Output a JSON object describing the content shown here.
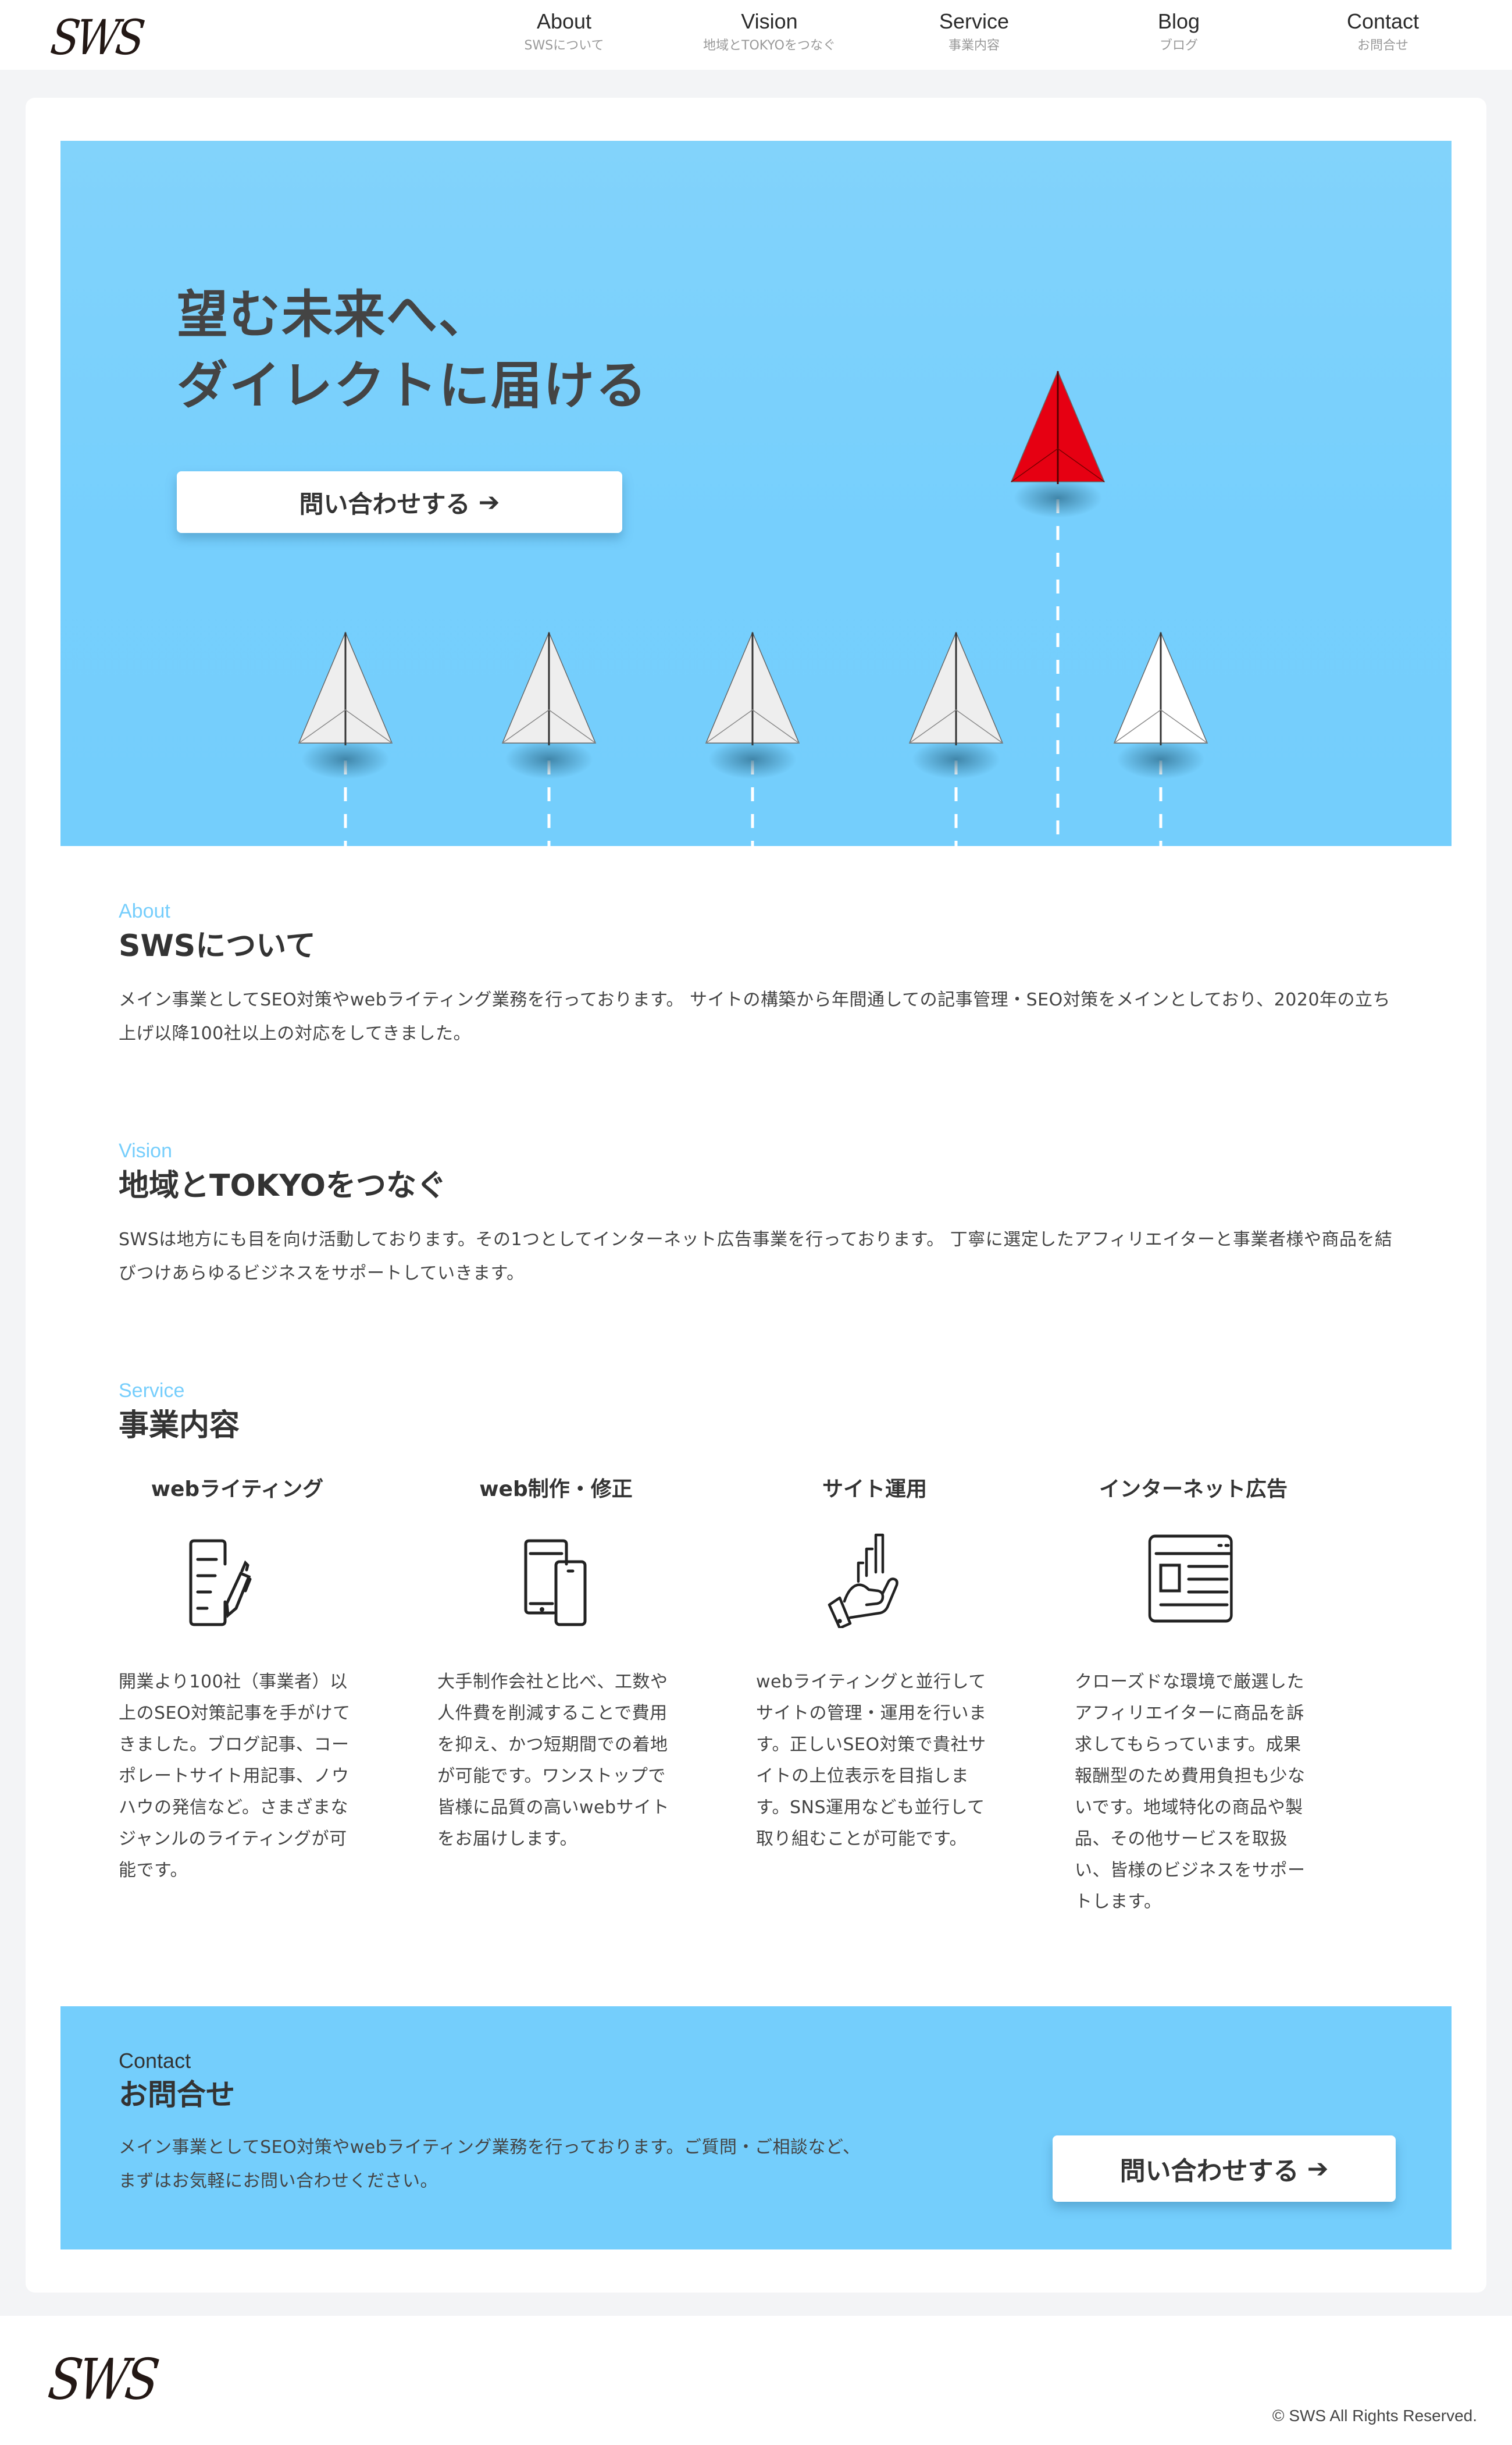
{
  "header": {
    "logo": "SWS",
    "nav": [
      {
        "en": "About",
        "ja": "SWSについて"
      },
      {
        "en": "Vision",
        "ja": "地域とTOKYOをつなぐ"
      },
      {
        "en": "Service",
        "ja": "事業内容"
      },
      {
        "en": "Blog",
        "ja": "ブログ"
      },
      {
        "en": "Contact",
        "ja": "お問合せ"
      }
    ]
  },
  "hero": {
    "title_line1": "望む未来へ、",
    "title_line2": "ダイレクトに届ける",
    "button_label": "問い合わせする",
    "button_arrow": "➔",
    "image": "paper-planes-red-leader"
  },
  "about": {
    "label": "About",
    "title": "SWSについて",
    "body": "メイン事業としてSEO対策やwebライティング業務を行っております。 サイトの構築から年間通しての記事管理・SEO対策をメインとしており、2020年の立ち上げ以降100社以上の対応をしてきました。"
  },
  "vision": {
    "label": "Vision",
    "title": "地域とTOKYOをつなぐ",
    "body": "SWSは地方にも目を向け活動しております。その1つとしてインターネット広告事業を行っております。 丁寧に選定したアフィリエイターと事業者様や商品を結びつけあらゆるビジネスをサポートしていきます。"
  },
  "service": {
    "label": "Service",
    "title": "事業内容",
    "items": [
      {
        "title": "webライティング",
        "icon": "document-pencil-icon",
        "body": "開業より100社（事業者）以上のSEO対策記事を手がけてきました。ブログ記事、コーポレートサイト用記事、ノウハウの発信など。さまざまなジャンルのライティングが可能です。"
      },
      {
        "title": "web制作・修正",
        "icon": "tablet-phone-icon",
        "body": "大手制作会社と比べ、工数や人件費を削減することで費用を抑え、かつ短期間での着地が可能です。ワンストップで皆様に品質の高いwebサイトをお届けします。"
      },
      {
        "title": "サイト運用",
        "icon": "hand-growth-chart-icon",
        "body": "webライティングと並行してサイトの管理・運用を行います。正しいSEO対策で貴社サイトの上位表示を目指します。SNS運用なども並行して取り組むことが可能です。"
      },
      {
        "title": "インターネット広告",
        "icon": "web-ad-layout-icon",
        "body": "クローズドな環境で厳選したアフィリエイターに商品を訴求してもらっています。成果報酬型のため費用負担も少ないです。地域特化の商品や製品、その他サービスを取扱い、皆様のビジネスをサポートします。"
      }
    ]
  },
  "contact": {
    "label": "Contact",
    "title": "お問合せ",
    "body": "メイン事業としてSEO対策やwebライティング業務を行っております。ご質問・ご相談など、まずはお気軽にお問い合わせください。",
    "button_label": "問い合わせする",
    "button_arrow": "➔"
  },
  "footer": {
    "logo": "SWS",
    "copyright": "© SWS All Rights Reserved."
  },
  "colors": {
    "accent": "#76cefc",
    "text": "#333333",
    "band": "#f3f4f6",
    "plane_red": "#e60012"
  }
}
